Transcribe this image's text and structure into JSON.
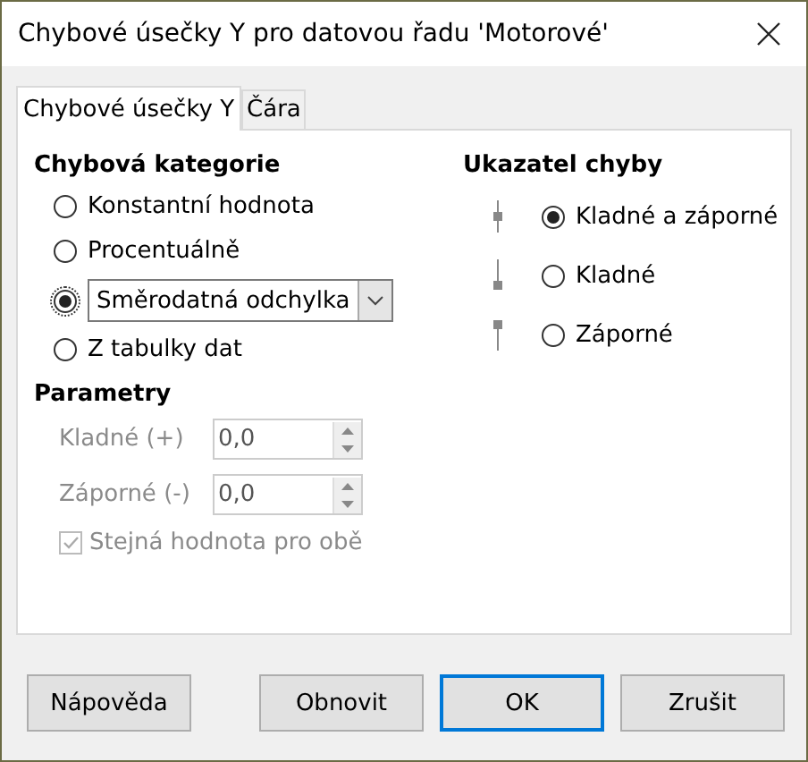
{
  "window": {
    "title": "Chybové úsečky Y pro datovou řadu 'Motorové'"
  },
  "tabs": [
    {
      "label": "Chybové úsečky Y",
      "selected": true
    },
    {
      "label": "Čára",
      "selected": false
    }
  ],
  "category": {
    "heading": "Chybová kategorie",
    "options": [
      {
        "kind": "radio",
        "label": "Konstantní hodnota",
        "selected": false
      },
      {
        "kind": "radio",
        "label": "Procentuálně",
        "selected": false
      },
      {
        "kind": "dropdown",
        "value": "Směrodatná odchylka",
        "selected": true
      },
      {
        "kind": "radio",
        "label": "Z tabulky dat",
        "selected": false
      }
    ]
  },
  "parameters": {
    "heading": "Parametry",
    "fields": [
      {
        "label": "Kladné (+)",
        "value": "0,0",
        "disabled": true
      },
      {
        "label": "Záporné (-)",
        "value": "0,0",
        "disabled": true
      }
    ],
    "same_value": {
      "label": "Stejná hodnota pro obě",
      "checked": true,
      "disabled": true
    }
  },
  "indicator": {
    "heading": "Ukazatel chyby",
    "options": [
      {
        "kind": "both",
        "label": "Kladné a záporné",
        "selected": true
      },
      {
        "kind": "positive",
        "label": "Kladné",
        "selected": false
      },
      {
        "kind": "negative",
        "label": "Záporné",
        "selected": false
      }
    ]
  },
  "buttons": [
    {
      "label": "Nápověda",
      "default": false
    },
    {
      "label": "Obnovit",
      "default": false
    },
    {
      "label": "OK",
      "default": true
    },
    {
      "label": "Zrušit",
      "default": false
    }
  ]
}
